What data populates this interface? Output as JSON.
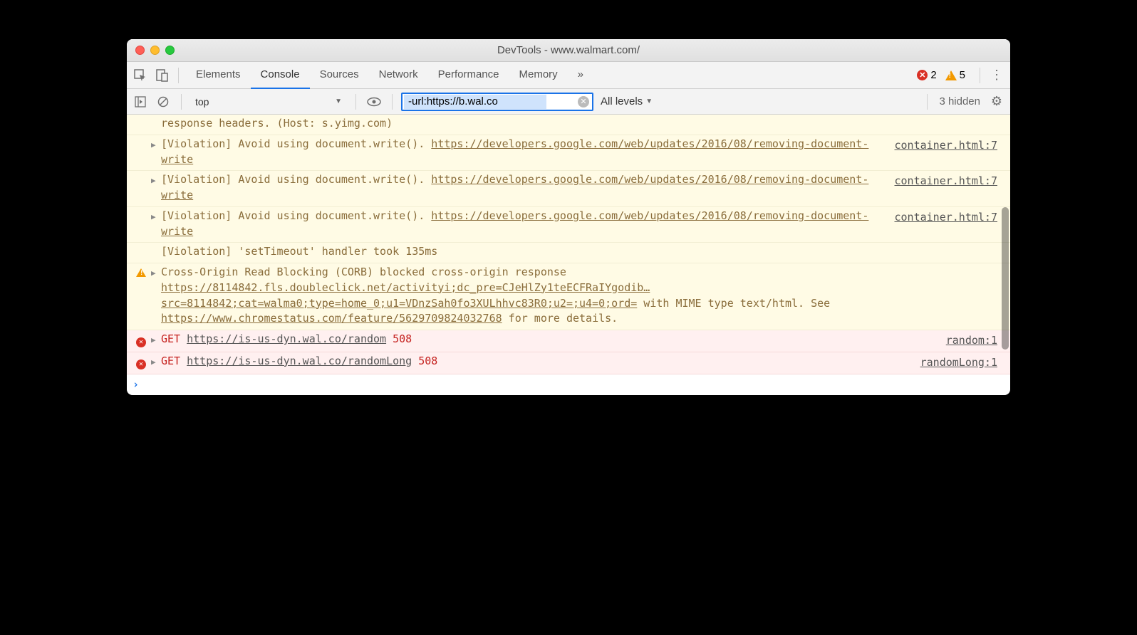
{
  "window": {
    "title": "DevTools - www.walmart.com/"
  },
  "tabs": {
    "elements": "Elements",
    "console": "Console",
    "sources": "Sources",
    "network": "Network",
    "performance": "Performance",
    "memory": "Memory"
  },
  "counts": {
    "errors": "2",
    "warnings": "5"
  },
  "filterbar": {
    "context": "top",
    "filter_value": "-url:https://b.wal.co",
    "levels": "All levels",
    "hidden": "3 hidden"
  },
  "rows": {
    "yimg": "response headers. (Host: s.yimg.com)",
    "viol_prefix": "[Violation] Avoid using document.write(). ",
    "viol_link": "https://developers.google.com/web/updates/2016/08/removing-document-write",
    "viol_src": "container.html:7",
    "timeout": "[Violation] 'setTimeout' handler took 135ms",
    "corb_a": "Cross-Origin Read Blocking (CORB) blocked cross-origin response ",
    "corb_url": "https://8114842.fls.doubleclick.net/activityi;dc_pre=CJeHlZy1teECFRaIYgodib…src=8114842;cat=walma0;type=home_0;u1=VDnzSah0fo3XULhhvc83R0;u2=;u4=0;ord=",
    "corb_b": " with MIME type text/html. See ",
    "corb_link2": "https://www.chromestatus.com/feature/5629709824032768",
    "corb_c": " for more details.",
    "err1_method": "GET",
    "err1_url": "https://is-us-dyn.wal.co/random",
    "err1_code": "508",
    "err1_src": "random:1",
    "err2_method": "GET",
    "err2_url": "https://is-us-dyn.wal.co/randomLong",
    "err2_code": "508",
    "err2_src": "randomLong:1"
  }
}
